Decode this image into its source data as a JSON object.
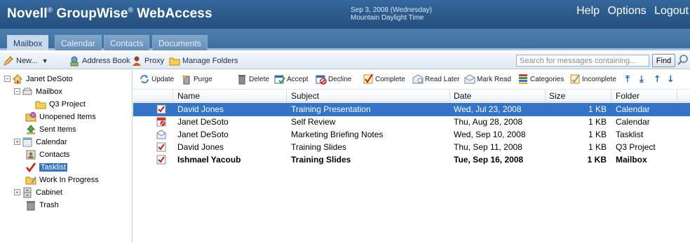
{
  "header": {
    "brand": "Novell",
    "brand_rest": "GroupWise",
    "brand_tail": "WebAccess",
    "reg": "®",
    "date_line1": "Sep 3, 2008 (Wednesday)",
    "date_line2": "Mountain Daylight Time",
    "nav": [
      "Help",
      "Options",
      "Logout"
    ]
  },
  "tabs": [
    {
      "label": "Mailbox",
      "active": true
    },
    {
      "label": "Calendar",
      "active": false
    },
    {
      "label": "Contacts",
      "active": false
    },
    {
      "label": "Documents",
      "active": false
    }
  ],
  "toolbar": {
    "new_label": "New...",
    "address_book_label": "Address Book",
    "proxy_label": "Proxy",
    "manage_folders_label": "Manage Folders",
    "search_placeholder": "Search for messages containing...",
    "find_label": "Find"
  },
  "tree": {
    "user": "Janet DeSoto",
    "nodes": [
      {
        "label": "Mailbox"
      },
      {
        "label": "Q3 Project"
      },
      {
        "label": "Unopened Items"
      },
      {
        "label": "Sent Items"
      },
      {
        "label": "Calendar"
      },
      {
        "label": "Contacts"
      },
      {
        "label": "Tasklist",
        "selected": true
      },
      {
        "label": "Work In Progress"
      },
      {
        "label": "Cabinet"
      },
      {
        "label": "Trash"
      }
    ]
  },
  "item_toolbar": {
    "update": "Update",
    "purge": "Purge",
    "delete": "Delete",
    "accept": "Accept",
    "decline": "Decline",
    "complete": "Complete",
    "read_later": "Read Later",
    "mark_read": "Mark Read",
    "categories": "Categories",
    "incomplete": "Incomplete"
  },
  "table": {
    "columns": [
      "Name",
      "Subject",
      "Date",
      "Size",
      "Folder"
    ],
    "rows": [
      {
        "name": "David Jones",
        "subject": "Training Presentation",
        "date": "Wed, Jul 23, 2008",
        "size": "1 KB",
        "folder": "Calendar",
        "selected": true,
        "bold": false,
        "icon": "task-check-icon"
      },
      {
        "name": "Janet DeSoto",
        "subject": "Self Review",
        "date": "Thu, Aug 28, 2008",
        "size": "1 KB",
        "folder": "Calendar",
        "selected": false,
        "bold": false,
        "icon": "task-declined-icon"
      },
      {
        "name": "Janet DeSoto",
        "subject": "Marketing Briefing Notes",
        "date": "Wed, Sep 10, 2008",
        "size": "1 KB",
        "folder": "Tasklist",
        "selected": false,
        "bold": false,
        "icon": "opened-mail-icon"
      },
      {
        "name": "David Jones",
        "subject": "Training Slides",
        "date": "Thu, Sep 11, 2008",
        "size": "1 KB",
        "folder": "Q3 Project",
        "selected": false,
        "bold": false,
        "icon": "task-check-icon"
      },
      {
        "name": "Ishmael Yacoub",
        "subject": "Training Slides",
        "date": "Tue, Sep 16, 2008",
        "size": "1 KB",
        "folder": "Mailbox",
        "selected": false,
        "bold": true,
        "icon": "task-check-icon"
      }
    ]
  },
  "colors": {
    "header": "#234f7d",
    "selection": "#3373c8",
    "tab_active": "#c6daec"
  }
}
